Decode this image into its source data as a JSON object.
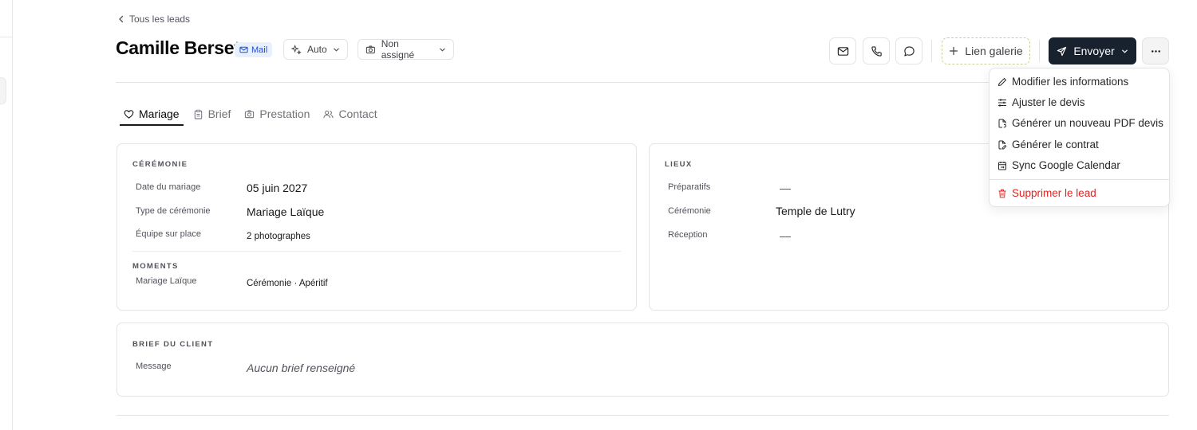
{
  "nav": {
    "back_label": "Tous les leads"
  },
  "lead": {
    "name": "Camille Berset",
    "source_badge": "Mail",
    "mode_label": "Auto",
    "assignee_label": "Non assigné"
  },
  "actions": {
    "galerie_label": "Lien galerie",
    "send_label": "Envoyer"
  },
  "tabs": [
    {
      "label": "Mariage",
      "icon": "heart-icon",
      "active": true
    },
    {
      "label": "Brief",
      "icon": "clipboard-icon",
      "active": false
    },
    {
      "label": "Prestation",
      "icon": "camera-icon",
      "active": false
    },
    {
      "label": "Contact",
      "icon": "users-icon",
      "active": false
    }
  ],
  "ceremonie": {
    "title": "CÉRÉMONIE",
    "rows": [
      {
        "label": "Date du mariage",
        "value": "05 juin 2027"
      },
      {
        "label": "Type de cérémonie",
        "value": "Mariage Laïque"
      },
      {
        "label": "Équipe sur place",
        "value": "2 photographes"
      }
    ],
    "moments_title": "MOMENTS",
    "moments": [
      {
        "label": "Mariage Laïque",
        "value": "Cérémonie · Apéritif"
      }
    ]
  },
  "lieux": {
    "title": "LIEUX",
    "rows": [
      {
        "label": "Préparatifs",
        "value": "—"
      },
      {
        "label": "Cérémonie",
        "value": "Temple de Lutry"
      },
      {
        "label": "Réception",
        "value": "—"
      }
    ]
  },
  "brief": {
    "title": "BRIEF DU CLIENT",
    "message_label": "Message",
    "message_value": "Aucun brief renseigné"
  },
  "menu": {
    "items": [
      {
        "label": "Modifier les informations",
        "icon": "pencil-icon"
      },
      {
        "label": "Ajuster le devis",
        "icon": "sliders-icon"
      },
      {
        "label": "Générer un nouveau PDF devis",
        "icon": "file-refresh-icon"
      },
      {
        "label": "Générer le contrat",
        "icon": "file-edit-icon"
      },
      {
        "label": "Sync Google Calendar",
        "icon": "calendar-sync-icon"
      }
    ],
    "danger_item": {
      "label": "Supprimer le lead",
      "icon": "trash-icon"
    }
  },
  "colors": {
    "primary_button": "#18212e",
    "badge_bg": "#e8f0fe",
    "badge_text": "#1d4ed8",
    "danger": "#dc2626",
    "galerie_border": "#c6d49b"
  }
}
